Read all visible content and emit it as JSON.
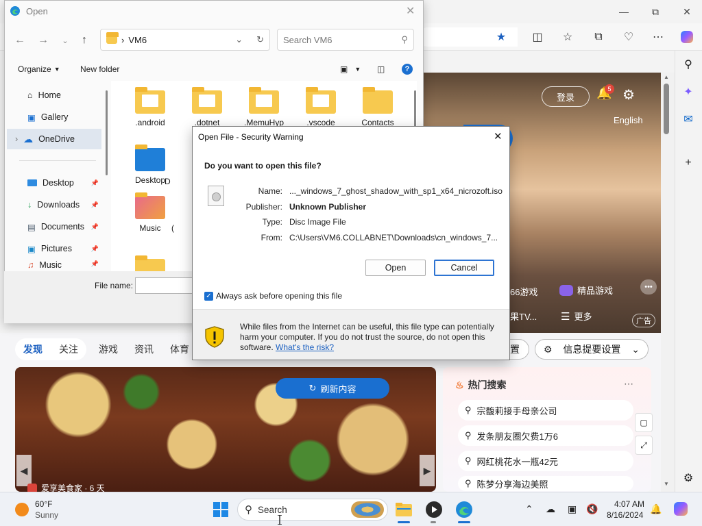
{
  "browser": {
    "hero": {
      "login_label": "登录",
      "notification_count": "5",
      "language": "English",
      "link_games_partial": "66游戏",
      "link_premium_games": "精品游戏",
      "link_tv_partial": "果TV...",
      "link_more": "更多",
      "ad_label": "广告"
    },
    "feed": {
      "tabs": [
        "发现",
        "关注",
        "游戏",
        "资讯",
        "体育"
      ],
      "settings_partial": "置",
      "info_settings": "信息提要设置",
      "refresh_label": "刷新内容",
      "card_caption": "爱享美食家 · 6 天"
    },
    "hot": {
      "title": "热门搜索",
      "items": [
        "宗馥莉接手母亲公司",
        "发条朋友圈欠费1万6",
        "网红桃花水一瓶42元",
        "陈梦分享海边美照"
      ]
    }
  },
  "file_dialog": {
    "title": "Open",
    "path_folder": "VM6",
    "search_placeholder": "Search VM6",
    "organize_label": "Organize",
    "new_folder_label": "New folder",
    "nav_items": [
      {
        "label": "Home"
      },
      {
        "label": "Gallery"
      },
      {
        "label": "OneDrive"
      },
      {
        "label": "Desktop"
      },
      {
        "label": "Downloads"
      },
      {
        "label": "Documents"
      },
      {
        "label": "Pictures"
      },
      {
        "label": "Music"
      }
    ],
    "files_row1": [
      ".android",
      ".dotnet",
      ".MemuHyp",
      ".vscode",
      "Contacts"
    ],
    "files_row2": [
      "Desktop",
      "D"
    ],
    "files_row3": [
      "Music",
      "("
    ],
    "filename_label": "File name:"
  },
  "security_dialog": {
    "title": "Open File - Security Warning",
    "question": "Do you want to open this file?",
    "fields": {
      "name_label": "Name:",
      "name_value": "..._windows_7_ghost_shadow_with_sp1_x64_nicrozoft.iso",
      "publisher_label": "Publisher:",
      "publisher_value": "Unknown Publisher",
      "type_label": "Type:",
      "type_value": "Disc Image File",
      "from_label": "From:",
      "from_value": "C:\\Users\\VM6.COLLABNET\\Downloads\\cn_windows_7..."
    },
    "open_label": "Open",
    "cancel_label": "Cancel",
    "always_ask_label": "Always ask before opening this file",
    "always_ask_checked": true,
    "warning_text": "While files from the Internet can be useful, this file type can potentially harm your computer. If you do not trust the source, do not open this software.",
    "risk_link": "What's the risk?"
  },
  "taskbar": {
    "weather_temp": "60°F",
    "weather_desc": "Sunny",
    "search_placeholder": "Search",
    "time": "4:07 AM",
    "date": "8/16/2024"
  },
  "colors": {
    "accent": "#1a6fd0",
    "folder": "#f7c94f",
    "warning_yellow": "#f5c400"
  },
  "icons": [
    "edge-logo-icon",
    "favorite-star-icon",
    "split-screen-icon",
    "favorites-icon",
    "collections-icon",
    "copilot-icon",
    "search-icon",
    "gear-icon",
    "bell-icon",
    "folder-icon",
    "shield-warning-icon",
    "windows-start-icon",
    "file-explorer-icon",
    "edge-icon"
  ]
}
